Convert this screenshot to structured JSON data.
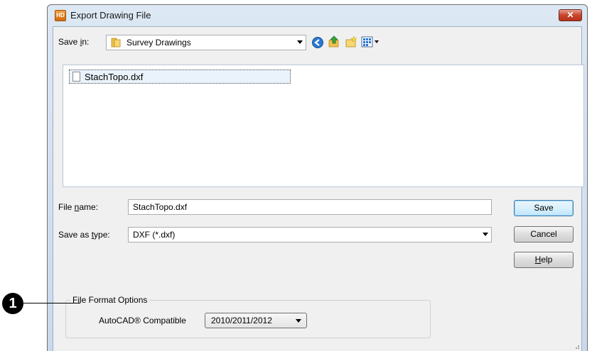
{
  "window": {
    "title": "Export Drawing File",
    "app_icon_label": "HD",
    "close_symbol": "✕"
  },
  "save_in": {
    "label": "Save in:",
    "mnemonic": "i",
    "folder": "Survey Drawings",
    "folder_icon": "folder-icon"
  },
  "toolbar": {
    "icons": [
      "back-icon",
      "up-folder-icon",
      "new-folder-icon",
      "view-menu-icon"
    ]
  },
  "file_list": {
    "items": [
      {
        "name": "StachTopo.dxf",
        "icon": "file-icon"
      }
    ]
  },
  "file_name": {
    "label": "File name:",
    "mnemonic": "n",
    "value": "StachTopo.dxf"
  },
  "save_as_type": {
    "label": "Save as type:",
    "mnemonic": "t",
    "value": "DXF (*.dxf)"
  },
  "buttons": {
    "save": "Save",
    "cancel": "Cancel",
    "help": "Help",
    "help_mnemonic": "H"
  },
  "file_format_options": {
    "legend": "File Format Options",
    "autocad_label": "AutoCAD® Compatible",
    "autocad_value": "2010/2011/2012"
  },
  "callout": {
    "number": "1"
  },
  "colors": {
    "accent": "#3c7fb1",
    "close_button": "#c8442c",
    "title_bar": "#dde8f4",
    "client_bg": "#f0f0f0"
  }
}
